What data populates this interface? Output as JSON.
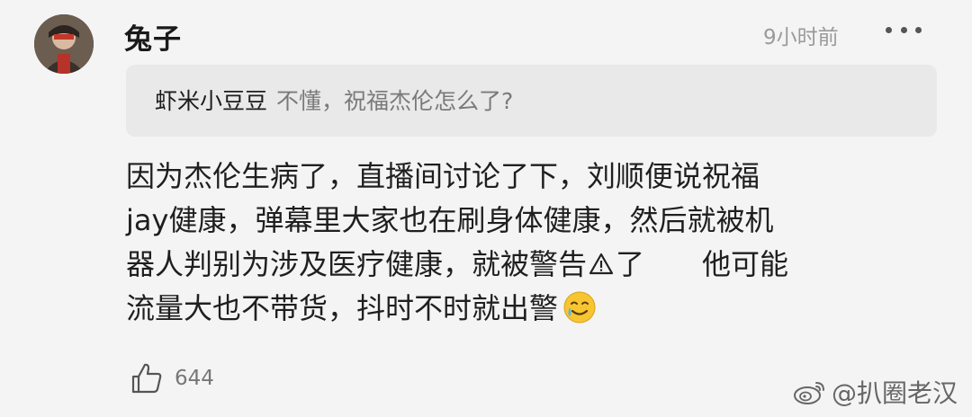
{
  "comment": {
    "username": "兔子",
    "time": "9小时前",
    "more_icon": "more-dots-icon",
    "quote": {
      "user": "虾米小豆豆",
      "text": "不懂，祝福杰伦怎么了?"
    },
    "lines": [
      "因为杰伦生病了，直播间讨论了下，刘顺便说祝福",
      "jay健康，弹幕里大家也在刷身体健康，然后就被机",
      "器人判别为涉及医疗健康，就被警告",
      "了　　他可能",
      "流量大也不带货，抖时不时就出警"
    ],
    "icons": {
      "warning": "warning-icon",
      "emoji": "sweat-smile-emoji",
      "like": "thumbs-up-icon"
    },
    "likes": "644"
  },
  "watermark": {
    "text": "@扒圈老汉",
    "icon": "weibo-logo-icon"
  }
}
